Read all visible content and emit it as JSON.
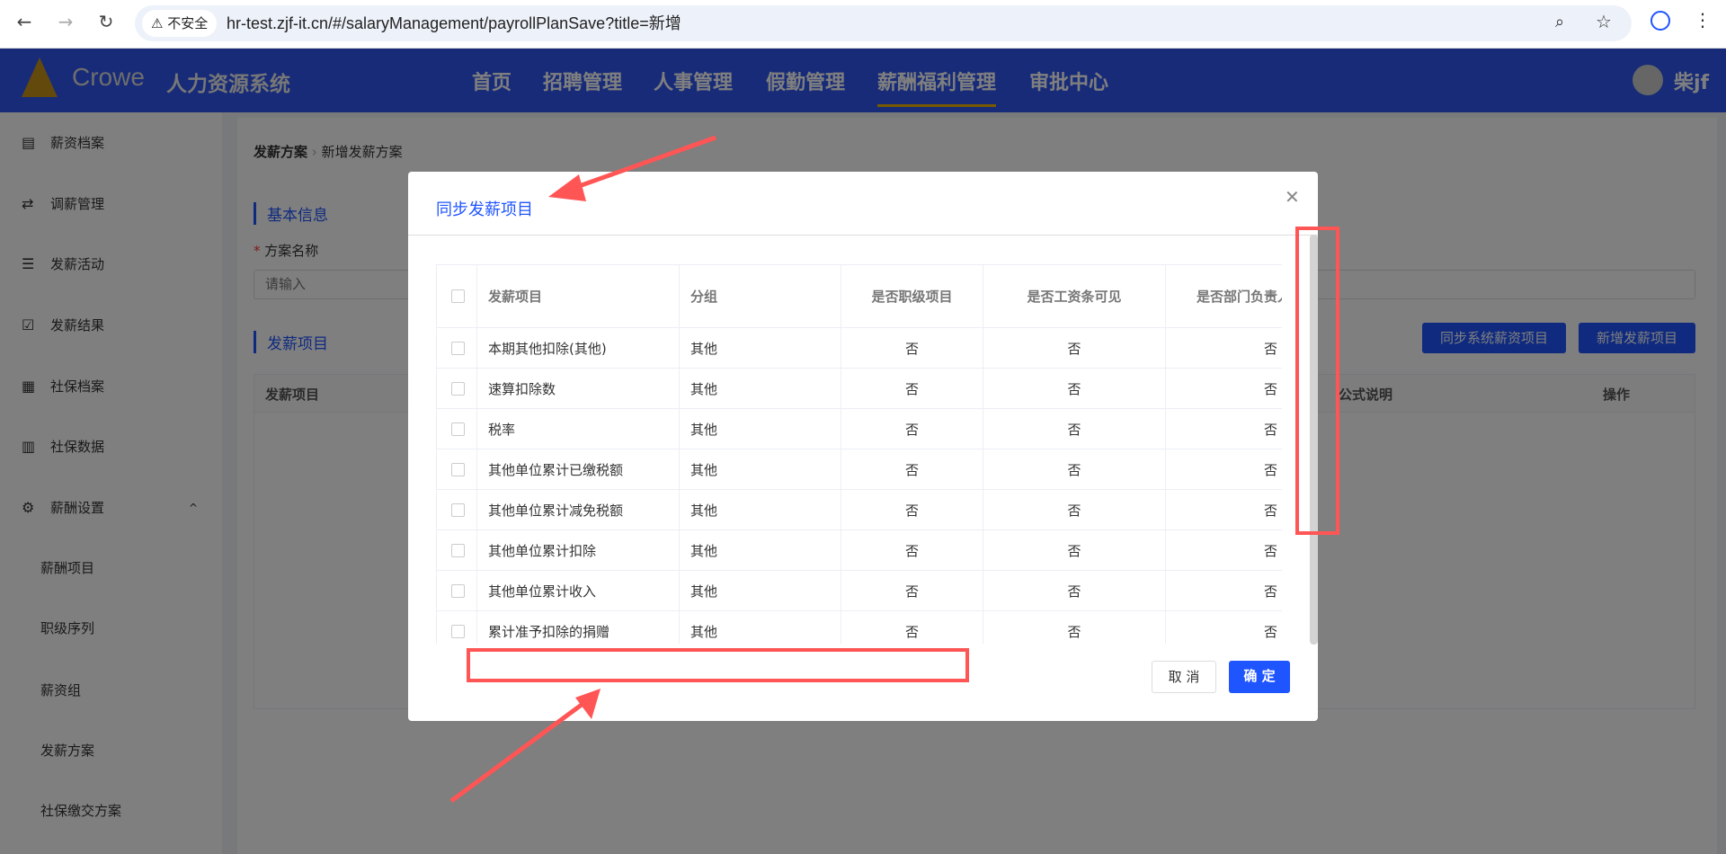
{
  "browser": {
    "security": "不安全",
    "url": "hr-test.zjf-it.cn/#/salaryManagement/payrollPlanSave?title=新增"
  },
  "header": {
    "brand": "Crowe",
    "system": "人力资源系统",
    "nav": [
      "首页",
      "招聘管理",
      "人事管理",
      "假勤管理",
      "薪酬福利管理",
      "审批中心"
    ],
    "active": "薪酬福利管理",
    "user": "柴jf"
  },
  "sidebar": {
    "items": [
      "薪资档案",
      "调薪管理",
      "发薪活动",
      "发薪结果",
      "社保档案",
      "社保数据",
      "薪酬设置",
      "薪酬项目",
      "职级序列",
      "薪资组",
      "发薪方案",
      "社保缴交方案"
    ]
  },
  "page": {
    "breadcrumb": [
      "发薪方案",
      "新增发薪方案"
    ],
    "section_basic": "基本信息",
    "plan_name_label": "方案名称",
    "plan_name_placeholder": "请输入",
    "section_items": "发薪项目",
    "sync_button": "同步系统薪资项目",
    "add_button": "新增发薪项目",
    "table_headers": [
      "发薪项目",
      "公式说明",
      "操作"
    ]
  },
  "modal": {
    "title": "同步发薪项目",
    "headers": [
      "发薪项目",
      "分组",
      "是否职级项目",
      "是否工资条可见",
      "是否部门负责人"
    ],
    "rows": [
      [
        "本期其他扣除(其他)",
        "其他",
        "否",
        "否",
        "否"
      ],
      [
        "速算扣除数",
        "其他",
        "否",
        "否",
        "否"
      ],
      [
        "税率",
        "其他",
        "否",
        "否",
        "否"
      ],
      [
        "其他单位累计已缴税额",
        "其他",
        "否",
        "否",
        "否"
      ],
      [
        "其他单位累计减免税额",
        "其他",
        "否",
        "否",
        "否"
      ],
      [
        "其他单位累计扣除",
        "其他",
        "否",
        "否",
        "否"
      ],
      [
        "其他单位累计收入",
        "其他",
        "否",
        "否",
        "否"
      ],
      [
        "累计准予扣除的捐赠",
        "其他",
        "否",
        "否",
        "否"
      ]
    ],
    "cancel": "取 消",
    "confirm": "确 定"
  },
  "colors": {
    "primary": "#1f55ff",
    "header": "#2f57f0",
    "annotation": "#ff5555"
  }
}
